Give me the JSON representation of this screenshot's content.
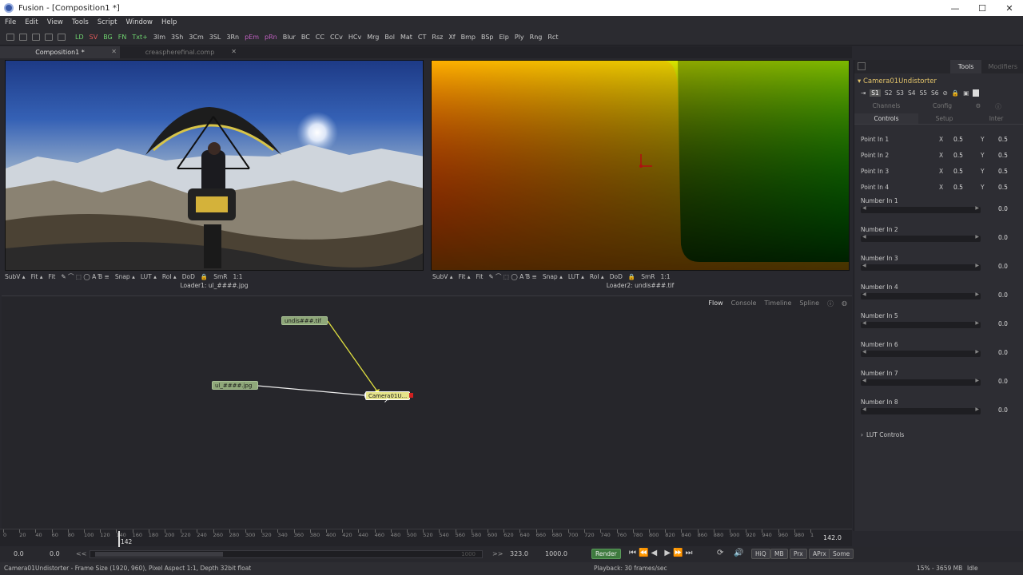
{
  "window": {
    "title": "Fusion - [Composition1 *]",
    "controls": [
      "—",
      "☐",
      "✕"
    ]
  },
  "menu": [
    "File",
    "Edit",
    "View",
    "Tools",
    "Script",
    "Window",
    "Help"
  ],
  "toolbar": {
    "items": [
      {
        "label": "LD",
        "color": "#6fd46f"
      },
      {
        "label": "SV",
        "color": "#e05a5a"
      },
      {
        "label": "BG",
        "color": "#6fd46f"
      },
      {
        "label": "FN",
        "color": "#6fd46f"
      },
      {
        "label": "Txt+",
        "color": "#6fd46f"
      },
      {
        "label": "3Im",
        "color": "#c8c8c8"
      },
      {
        "label": "3Sh",
        "color": "#c8c8c8"
      },
      {
        "label": "3Cm",
        "color": "#c8c8c8"
      },
      {
        "label": "3SL",
        "color": "#c8c8c8"
      },
      {
        "label": "3Rn",
        "color": "#c8c8c8"
      },
      {
        "label": "pEm",
        "color": "#c060c0"
      },
      {
        "label": "pRn",
        "color": "#c060c0"
      },
      {
        "label": "Blur",
        "color": "#c8c8c8"
      },
      {
        "label": "BC",
        "color": "#c8c8c8"
      },
      {
        "label": "CC",
        "color": "#c8c8c8"
      },
      {
        "label": "CCv",
        "color": "#c8c8c8"
      },
      {
        "label": "HCv",
        "color": "#c8c8c8"
      },
      {
        "label": "Mrg",
        "color": "#c8c8c8"
      },
      {
        "label": "Bol",
        "color": "#c8c8c8"
      },
      {
        "label": "Mat",
        "color": "#c8c8c8"
      },
      {
        "label": "CT",
        "color": "#c8c8c8"
      },
      {
        "label": "Rsz",
        "color": "#c8c8c8"
      },
      {
        "label": "Xf",
        "color": "#c8c8c8"
      },
      {
        "label": "Bmp",
        "color": "#c8c8c8"
      },
      {
        "label": "BSp",
        "color": "#c8c8c8"
      },
      {
        "label": "Elp",
        "color": "#c8c8c8"
      },
      {
        "label": "Ply",
        "color": "#c8c8c8"
      },
      {
        "label": "Rng",
        "color": "#c8c8c8"
      },
      {
        "label": "Rct",
        "color": "#c8c8c8"
      }
    ]
  },
  "comp_tabs": [
    {
      "label": "Composition1 *",
      "active": true
    },
    {
      "label": "creaspherefinal.comp",
      "active": false
    }
  ],
  "viewers": [
    {
      "name": "Loader1: ul_####.jpg"
    },
    {
      "name": "Loader2: undis###.tif"
    }
  ],
  "viewer_toolbar": [
    "SubV ▴",
    "Fit ▴",
    "Fit",
    "Snap ▴",
    "LUT ▴",
    "RoI ▴",
    "DoD",
    "SmR",
    "1:1"
  ],
  "flow": {
    "tabs": [
      "Flow",
      "Console",
      "Timeline",
      "Spline"
    ],
    "nodes": [
      {
        "id": "undis",
        "label": "undis###.tif",
        "color": "#8fa87a"
      },
      {
        "id": "ul",
        "label": "ul_####.jpg",
        "color": "#8fa87a"
      },
      {
        "id": "cam",
        "label": "Camera01U...",
        "color": "#e6e48a"
      }
    ]
  },
  "right_panel": {
    "tabs": [
      "Tools",
      "Modifiers"
    ],
    "tool_name": "Camera01Undistorter",
    "slots": [
      "S1",
      "S2",
      "S3",
      "S4",
      "S5",
      "S6"
    ],
    "subtabs_top": [
      "Channels",
      "Config"
    ],
    "subtabs": [
      "Controls",
      "Setup",
      "Inter"
    ],
    "points": [
      {
        "label": "Point In 1",
        "x": "0.5",
        "y": "0.5"
      },
      {
        "label": "Point In 2",
        "x": "0.5",
        "y": "0.5"
      },
      {
        "label": "Point In 3",
        "x": "0.5",
        "y": "0.5"
      },
      {
        "label": "Point In 4",
        "x": "0.5",
        "y": "0.5"
      }
    ],
    "numbers": [
      {
        "label": "Number In 1",
        "value": "0.0"
      },
      {
        "label": "Number In 2",
        "value": "0.0"
      },
      {
        "label": "Number In 3",
        "value": "0.0"
      },
      {
        "label": "Number In 4",
        "value": "0.0"
      },
      {
        "label": "Number In 5",
        "value": "0.0"
      },
      {
        "label": "Number In 6",
        "value": "0.0"
      },
      {
        "label": "Number In 7",
        "value": "0.0"
      },
      {
        "label": "Number In 8",
        "value": "0.0"
      }
    ],
    "lut_label": "LUT Controls",
    "x_label": "X",
    "y_label": "Y"
  },
  "timeline": {
    "ticks": [
      "0",
      "20",
      "40",
      "60",
      "80",
      "100",
      "120",
      "140",
      "160",
      "180",
      "200",
      "220",
      "240",
      "260",
      "280",
      "300",
      "320",
      "340",
      "360",
      "380",
      "400",
      "420",
      "440",
      "460",
      "480",
      "500",
      "520",
      "540",
      "560",
      "580",
      "600",
      "620",
      "640",
      "660",
      "680",
      "700",
      "720",
      "740",
      "760",
      "780",
      "800",
      "820",
      "840",
      "860",
      "880",
      "900",
      "920",
      "940",
      "960",
      "980",
      "1"
    ],
    "current": "142",
    "end_readout": "142.0"
  },
  "transport": {
    "start": "0.0",
    "render_start": "0.0",
    "range_end": "1000",
    "render_end": "323.0",
    "global_end": "1000.0",
    "render_label": "Render",
    "toggles": [
      "HiQ",
      "MB",
      "Prx",
      "APrx",
      "Some"
    ]
  },
  "status": {
    "left": "Camera01Undistorter - Frame Size (1920, 960), Pixel Aspect 1:1, Depth 32bit float",
    "center": "Playback: 30 frames/sec",
    "mem": "15% - 3659 MB",
    "state": "Idle"
  }
}
